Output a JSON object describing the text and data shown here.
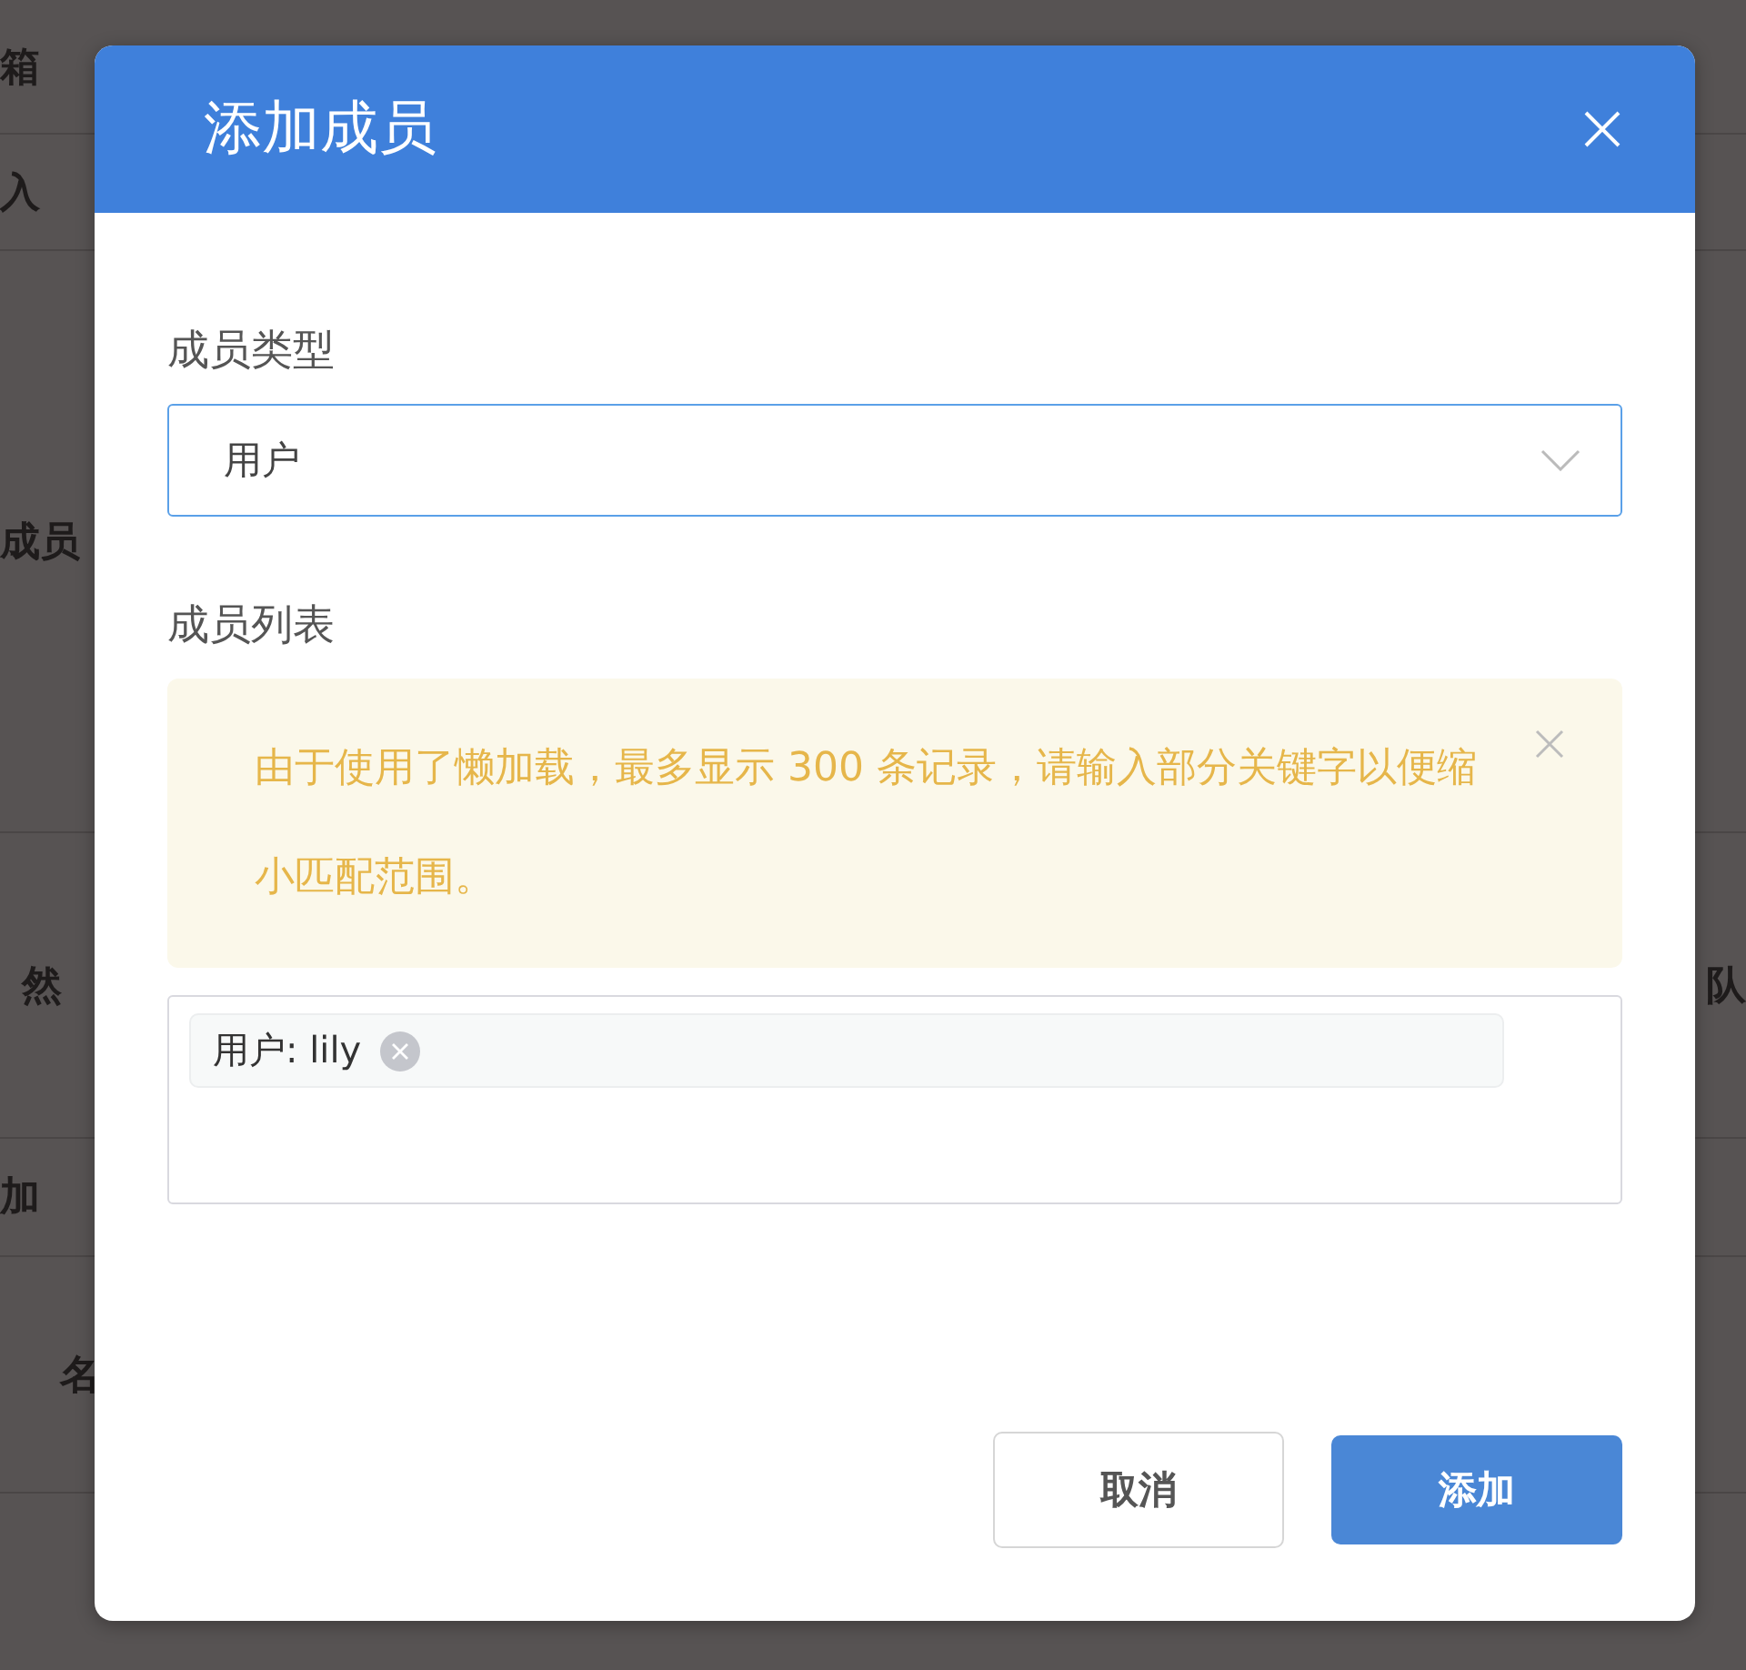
{
  "background": {
    "rows": [
      {
        "left": "箱"
      },
      {
        "left": "入"
      },
      {
        "left": "成员"
      },
      {
        "left": "然",
        "right": "队"
      },
      {
        "left": "加"
      },
      {
        "left": "名"
      }
    ]
  },
  "dialog": {
    "title": "添加成员",
    "member_type": {
      "label": "成员类型",
      "value": "用户"
    },
    "member_list": {
      "label": "成员列表",
      "alert": "由于使用了懒加载，最多显示 300 条记录，请输入部分关键字以便缩小匹配范围。",
      "tags": [
        "用户: lily"
      ]
    },
    "buttons": [
      {
        "label": "取消",
        "kind": "secondary"
      },
      {
        "label": "添加",
        "kind": "primary"
      }
    ]
  }
}
